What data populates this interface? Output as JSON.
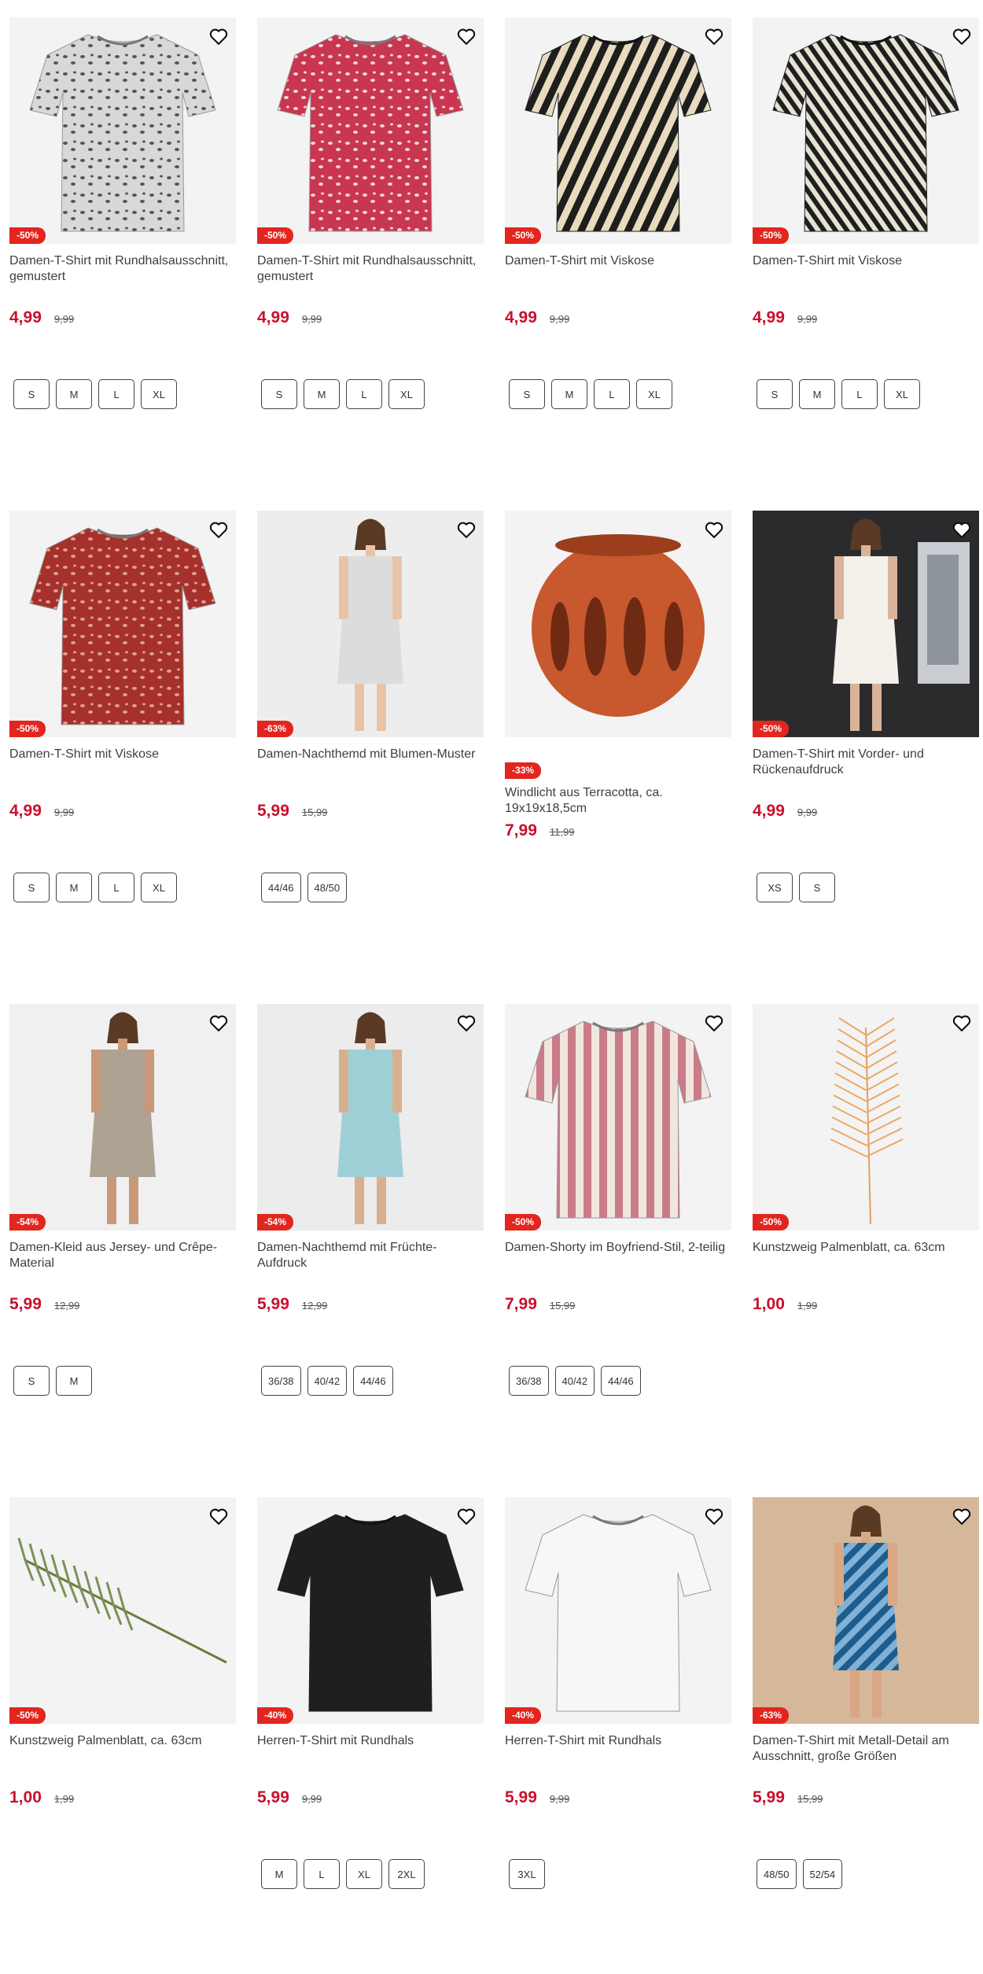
{
  "colors": {
    "accent": "#c8102e",
    "badge": "#e2261f"
  },
  "products": [
    {
      "title": "Damen-T-Shirt mit Rundhalsausschnitt, gemustert",
      "price": "4,99",
      "old_price": "9,99",
      "badge": "-50%",
      "sizes": [
        "S",
        "M",
        "L",
        "XL"
      ],
      "image": "leopard-tshirt"
    },
    {
      "title": "Damen-T-Shirt mit Rundhalsausschnitt, gemustert",
      "price": "4,99",
      "old_price": "9,99",
      "badge": "-50%",
      "sizes": [
        "S",
        "M",
        "L",
        "XL"
      ],
      "image": "red-pattern-tshirt"
    },
    {
      "title": "Damen-T-Shirt mit Viskose",
      "price": "4,99",
      "old_price": "9,99",
      "badge": "-50%",
      "sizes": [
        "S",
        "M",
        "L",
        "XL"
      ],
      "image": "zebra-tshirt"
    },
    {
      "title": "Damen-T-Shirt mit Viskose",
      "price": "4,99",
      "old_price": "9,99",
      "badge": "-50%",
      "sizes": [
        "S",
        "M",
        "L",
        "XL"
      ],
      "image": "palm-print-tshirt"
    },
    {
      "title": "Damen-T-Shirt mit Viskose",
      "price": "4,99",
      "old_price": "9,99",
      "badge": "-50%",
      "sizes": [
        "S",
        "M",
        "L",
        "XL"
      ],
      "image": "red-geo-tshirt"
    },
    {
      "title": "Damen-Nachthemd mit Blumen-Muster",
      "price": "5,99",
      "old_price": "15,99",
      "badge": "-63%",
      "sizes": [
        "44/46",
        "48/50"
      ],
      "image": "floral-nightdress"
    },
    {
      "title": "Windlicht aus Terracotta, ca. 19x19x18,5cm",
      "price": "7,99",
      "old_price": "11,99",
      "badge": "-33%",
      "sizes": [],
      "image": "terracotta-lantern"
    },
    {
      "title": "Damen-T-Shirt mit Vorder- und Rückenaufdruck",
      "price": "4,99",
      "old_price": "9,99",
      "badge": "-50%",
      "sizes": [
        "XS",
        "S"
      ],
      "image": "white-tshirt-model"
    },
    {
      "title": "Damen-Kleid aus Jersey- und Crêpe-Material",
      "price": "5,99",
      "old_price": "12,99",
      "badge": "-54%",
      "sizes": [
        "S",
        "M"
      ],
      "image": "beige-dress"
    },
    {
      "title": "Damen-Nachthemd mit Früchte-Aufdruck",
      "price": "5,99",
      "old_price": "12,99",
      "badge": "-54%",
      "sizes": [
        "36/38",
        "40/42",
        "44/46"
      ],
      "image": "blue-nightdress"
    },
    {
      "title": "Damen-Shorty im Boyfriend-Stil, 2-teilig",
      "price": "7,99",
      "old_price": "15,99",
      "badge": "-50%",
      "sizes": [
        "36/38",
        "40/42",
        "44/46"
      ],
      "image": "striped-pyjama"
    },
    {
      "title": "Kunstzweig Palmenblatt, ca. 63cm",
      "price": "1,00",
      "old_price": "1,99",
      "badge": "-50%",
      "sizes": [],
      "image": "orange-palm-leaf"
    },
    {
      "title": "Kunstzweig Palmenblatt, ca. 63cm",
      "price": "1,00",
      "old_price": "1,99",
      "badge": "-50%",
      "sizes": [],
      "image": "green-palm-leaf"
    },
    {
      "title": "Herren-T-Shirt mit Rundhals",
      "price": "5,99",
      "old_price": "9,99",
      "badge": "-40%",
      "sizes": [
        "M",
        "L",
        "XL",
        "2XL"
      ],
      "image": "black-tshirt"
    },
    {
      "title": "Herren-T-Shirt mit Rundhals",
      "price": "5,99",
      "old_price": "9,99",
      "badge": "-40%",
      "sizes": [
        "3XL"
      ],
      "image": "white-tshirt"
    },
    {
      "title": "Damen-T-Shirt mit Metall-Detail am Ausschnitt, große Größen",
      "price": "5,99",
      "old_price": "15,99",
      "badge": "-63%",
      "sizes": [
        "48/50",
        "52/54"
      ],
      "image": "blue-blouse-model"
    }
  ]
}
